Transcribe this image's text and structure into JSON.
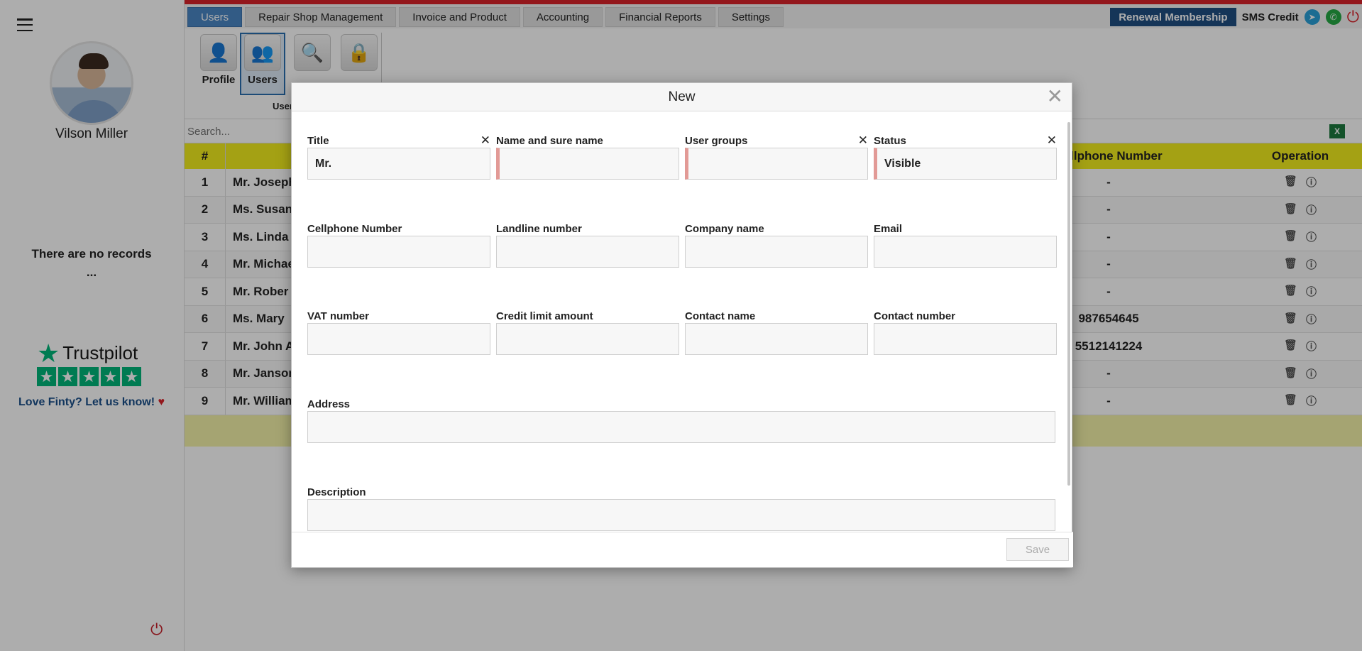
{
  "sidebar": {
    "user_name": "Vilson Miller",
    "no_records": "There are no records",
    "no_records_ellipsis": "...",
    "trustpilot_brand": "Trustpilot",
    "trustpilot_cta": "Love Finty? Let us know!"
  },
  "nav": {
    "tabs": [
      {
        "label": "Users"
      },
      {
        "label": "Repair Shop Management"
      },
      {
        "label": "Invoice and Product"
      },
      {
        "label": "Accounting"
      },
      {
        "label": "Financial Reports"
      },
      {
        "label": "Settings"
      }
    ],
    "renewal_label": "Renewal Membership",
    "sms_label": "SMS Credit"
  },
  "toolbar": {
    "profile_label": "Profile",
    "users_label": "Users",
    "group_label": "User"
  },
  "search": {
    "placeholder": "Search..."
  },
  "table": {
    "headers": {
      "num": "#",
      "cellphone": "Cellphone Number",
      "operation": "Operation"
    },
    "rows": [
      {
        "num": "1",
        "name": "Mr. Joseph",
        "cellphone": "-"
      },
      {
        "num": "2",
        "name": "Ms. Susan",
        "cellphone": "-"
      },
      {
        "num": "3",
        "name": "Ms. Linda",
        "cellphone": "-"
      },
      {
        "num": "4",
        "name": "Mr. Michae",
        "cellphone": "-"
      },
      {
        "num": "5",
        "name": "Mr. Rober",
        "cellphone": "-"
      },
      {
        "num": "6",
        "name": "Ms. Mary",
        "cellphone": "987654645"
      },
      {
        "num": "7",
        "name": "Mr. John A",
        "cellphone": "5512141224"
      },
      {
        "num": "8",
        "name": "Mr. Janson",
        "cellphone": "-"
      },
      {
        "num": "9",
        "name": "Mr. William",
        "cellphone": "-"
      }
    ]
  },
  "modal": {
    "title": "New",
    "save_label": "Save",
    "fields": {
      "title": {
        "label": "Title",
        "value": "Mr."
      },
      "name": {
        "label": "Name and sure name",
        "value": ""
      },
      "user_groups": {
        "label": "User groups",
        "value": ""
      },
      "status": {
        "label": "Status",
        "value": "Visible"
      },
      "cellphone": {
        "label": "Cellphone Number",
        "value": ""
      },
      "landline": {
        "label": "Landline number",
        "value": ""
      },
      "company": {
        "label": "Company name",
        "value": ""
      },
      "email": {
        "label": "Email",
        "value": ""
      },
      "vat": {
        "label": "VAT number",
        "value": ""
      },
      "credit_limit": {
        "label": "Credit limit amount",
        "value": ""
      },
      "contact_name": {
        "label": "Contact name",
        "value": ""
      },
      "contact_number": {
        "label": "Contact number",
        "value": ""
      },
      "address": {
        "label": "Address",
        "value": ""
      },
      "description": {
        "label": "Description",
        "value": ""
      }
    }
  },
  "icons": {
    "menu": "hamburger-icon",
    "power": "power-icon",
    "telegram": "telegram-icon",
    "whatsapp": "whatsapp-icon",
    "excel": "excel-icon",
    "delete": "trash-icon",
    "info": "info-icon",
    "close": "close-icon"
  },
  "colors": {
    "accent_red": "#d9222a",
    "active_tab": "#4a86c5",
    "renewal_bg": "#1f4f82",
    "table_header": "#f2ee1e",
    "required_marker": "#e29a96",
    "trustpilot_green": "#00b67a"
  }
}
